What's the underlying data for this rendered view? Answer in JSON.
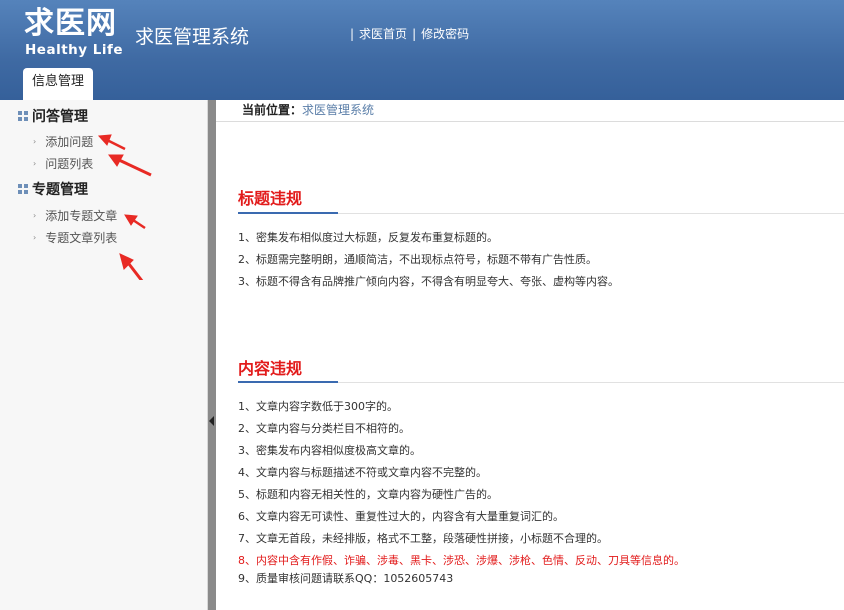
{
  "header": {
    "logo_main": "求医网",
    "logo_sub": "Healthy Life",
    "system_title": "求医管理系统",
    "links": [
      "求医首页",
      "修改密码"
    ],
    "separator": "|",
    "active_tab": "信息管理"
  },
  "sidebar": {
    "groups": [
      {
        "title": "问答管理",
        "items": [
          "添加问题",
          "问题列表"
        ]
      },
      {
        "title": "专题管理",
        "items": [
          "添加专题文章",
          "专题文章列表"
        ]
      }
    ],
    "arrow_glyph": "›"
  },
  "breadcrumb": {
    "label": "当前位置：",
    "current": "求医管理系统"
  },
  "sections": [
    {
      "title": "标题违规",
      "rules": [
        "1、密集发布相似度过大标题，反复发布重复标题的。",
        "2、标题需完整明朗，通顺简洁，不出现标点符号，标题不带有广告性质。",
        "3、标题不得含有品牌推广倾向内容，不得含有明显夸大、夸张、虚构等内容。"
      ]
    },
    {
      "title": "内容违规",
      "rules": [
        "1、文章内容字数低于300字的。",
        "2、文章内容与分类栏目不相符的。",
        "3、密集发布内容相似度极高文章的。",
        "4、文章内容与标题描述不符或文章内容不完整的。",
        "5、标题和内容无相关性的，文章内容为硬性广告的。",
        "6、文章内容无可读性、重复性过大的，内容含有大量重复词汇的。",
        "7、文章无首段，未经排版，格式不工整，段落硬性拼接，小标题不合理的。",
        "8、内容中含有作假、诈骗、涉毒、黑卡、涉恐、涉爆、涉枪、色情、反动、刀具等信息的。",
        "9、质量审核问题请联系QQ：1052605743"
      ]
    }
  ],
  "colors": {
    "header_blue": "#3f6aa3",
    "warning_red": "#e21b1b",
    "accent_blue": "#3a6ab0"
  }
}
